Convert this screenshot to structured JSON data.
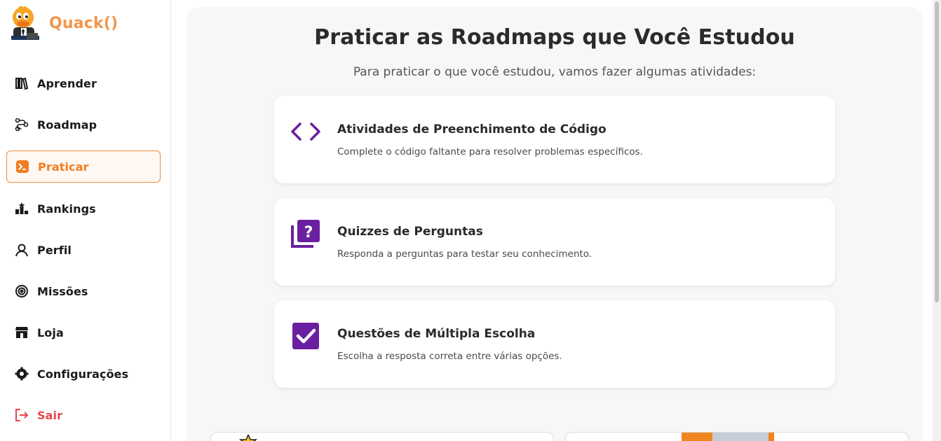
{
  "app": {
    "name": "Quack()"
  },
  "sidebar": {
    "items": [
      {
        "label": "Aprender",
        "icon": "books-icon"
      },
      {
        "label": "Roadmap",
        "icon": "roadmap-icon"
      },
      {
        "label": "Praticar",
        "icon": "terminal-icon",
        "active": true
      },
      {
        "label": "Rankings",
        "icon": "podium-icon"
      },
      {
        "label": "Perfil",
        "icon": "user-icon"
      },
      {
        "label": "Missões",
        "icon": "target-icon"
      },
      {
        "label": "Loja",
        "icon": "store-icon"
      },
      {
        "label": "Configurações",
        "icon": "settings-icon"
      },
      {
        "label": "Sair",
        "icon": "logout-icon"
      }
    ]
  },
  "main": {
    "title": "Praticar as Roadmaps que Você Estudou",
    "subtitle": "Para praticar o que você estudou, vamos fazer algumas atividades:",
    "cards": [
      {
        "title": "Atividades de Preenchimento de Código",
        "description": "Complete o código faltante para resolver problemas específicos.",
        "icon": "code-brackets-icon"
      },
      {
        "title": "Quizzes de Perguntas",
        "description": "Responda a perguntas para testar seu conhecimento.",
        "icon": "quiz-icon"
      },
      {
        "title": "Questões de Múltipla Escolha",
        "description": "Escolha a resposta correta entre várias opções.",
        "icon": "checkbox-icon"
      }
    ]
  },
  "colors": {
    "accent": "#f07d22",
    "brand": "#f4954a",
    "purple": "#6a1fa0",
    "danger": "#e5484d"
  }
}
